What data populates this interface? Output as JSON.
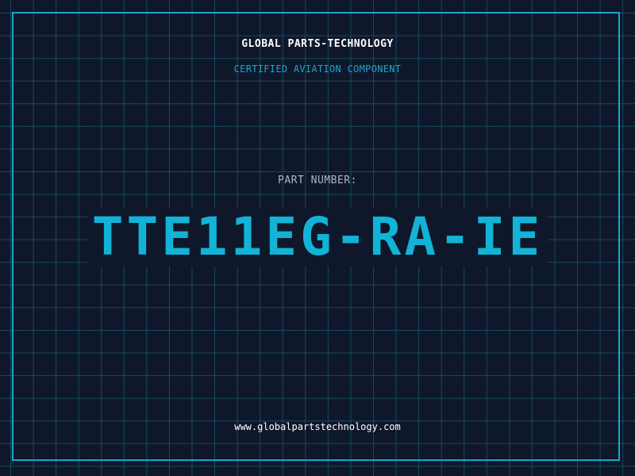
{
  "header": {
    "company": "GLOBAL PARTS-TECHNOLOGY",
    "subtitle": "CERTIFIED AVIATION COMPONENT"
  },
  "part": {
    "label": "PART NUMBER:",
    "number": "TTE11EG-RA-IE"
  },
  "footer": {
    "url": "www.globalpartstechnology.com"
  },
  "colors": {
    "background": "#0f182b",
    "accent": "#12b3d6",
    "grid": "#226e8c",
    "text": "#ffffff",
    "muted": "#a9b7c9"
  }
}
